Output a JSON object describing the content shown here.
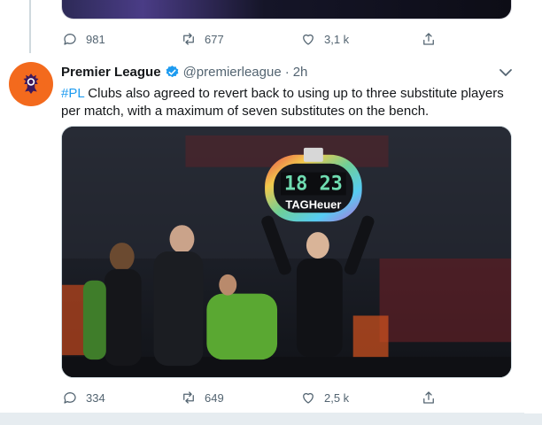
{
  "prev_tweet": {
    "replies": "981",
    "retweets": "677",
    "likes": "3,1 k"
  },
  "tweet": {
    "author_name": "Premier League",
    "handle": "@premierleague",
    "separator": "·",
    "time": "2h",
    "hashtag": "#PL",
    "text": " Clubs also agreed to revert back to using up to three substitute players per match, with a maximum of seven substitutes on the bench.",
    "board_numbers": "18 23",
    "board_brand": "TAGHeuer",
    "replies": "334",
    "retweets": "649",
    "likes": "2,5 k"
  },
  "colors": {
    "accent": "#1d9bf0",
    "avatar_bg": "#f36a1d",
    "muted": "#536471"
  }
}
